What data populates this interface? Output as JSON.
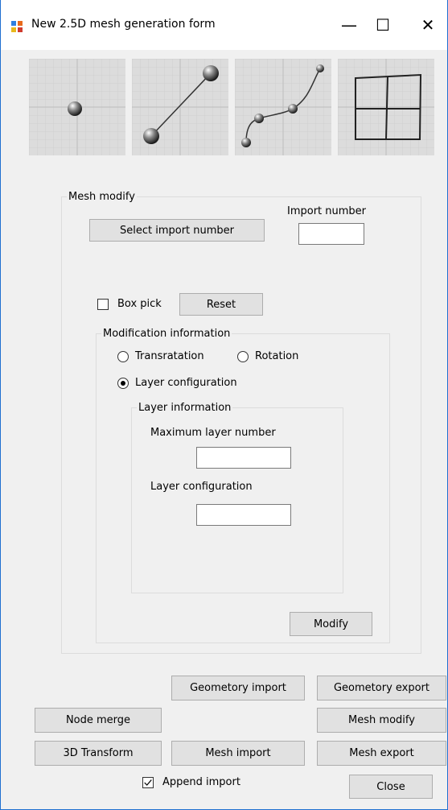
{
  "window": {
    "title": "New 2.5D mesh generation form",
    "minimize_glyph": "—",
    "maximize_glyph": "☐",
    "close_glyph": "✕"
  },
  "toolbar": {
    "thumbnails": [
      "point-geometry-icon",
      "line-geometry-icon",
      "curve-geometry-icon",
      "mesh-grid-icon"
    ]
  },
  "mesh_modify": {
    "legend": "Mesh modify",
    "select_import_button": "Select import number",
    "import_number_label": "Import number",
    "import_number_value": "",
    "box_pick_label": "Box pick",
    "box_pick_checked": false,
    "reset_button": "Reset",
    "modification": {
      "legend": "Modification information",
      "transratation_label": "Transratation",
      "rotation_label": "Rotation",
      "layer_configuration_label": "Layer configuration",
      "selected": "Layer configuration",
      "layer_info": {
        "legend": "Layer information",
        "max_layer_label": "Maximum layer number",
        "max_layer_value": "",
        "layer_config_label": "Layer configuration",
        "layer_config_value": ""
      }
    },
    "modify_button": "Modify"
  },
  "buttons": {
    "geometry_import": "Geometory import",
    "geometry_export": "Geometory export",
    "node_merge": "Node merge",
    "mesh_modify": "Mesh modify",
    "transform_3d": "3D Transform",
    "mesh_import": "Mesh import",
    "mesh_export": "Mesh export",
    "close": "Close"
  },
  "append_import": {
    "label": "Append import",
    "checked": true
  }
}
